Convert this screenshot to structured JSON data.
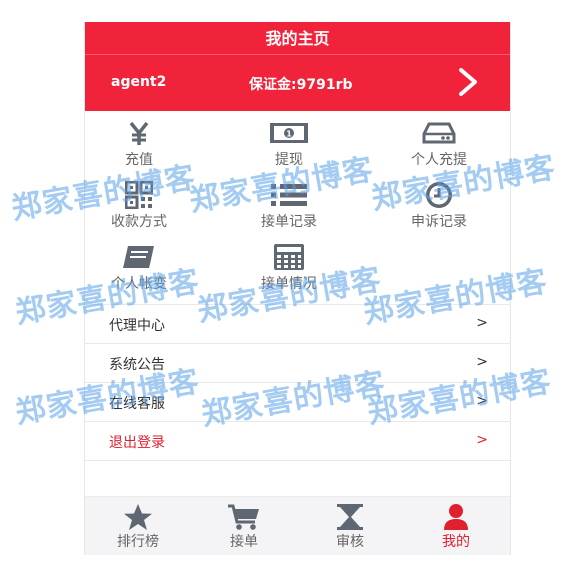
{
  "header": {
    "title": "我的主页"
  },
  "user": {
    "name": "agent2",
    "deposit": "保证金:9791rb"
  },
  "grid": [
    {
      "label": "充值",
      "icon": "yen-icon"
    },
    {
      "label": "提现",
      "icon": "banknote-icon"
    },
    {
      "label": "个人充提",
      "icon": "hard-drive-icon"
    },
    {
      "label": "收款方式",
      "icon": "qrcode-icon"
    },
    {
      "label": "接单记录",
      "icon": "list-icon"
    },
    {
      "label": "申诉记录",
      "icon": "clock-icon"
    },
    {
      "label": "个人帐变",
      "icon": "book-icon"
    },
    {
      "label": "接单情况",
      "icon": "calculator-icon"
    }
  ],
  "menu": [
    {
      "label": "代理中心",
      "chevron": ">"
    },
    {
      "label": "系统公告",
      "chevron": ">"
    },
    {
      "label": "在线客服",
      "chevron": ">"
    },
    {
      "label": "退出登录",
      "chevron": ">"
    }
  ],
  "tabs": [
    {
      "label": "排行榜",
      "icon": "star-icon"
    },
    {
      "label": "接单",
      "icon": "cart-icon"
    },
    {
      "label": "审核",
      "icon": "hourglass-icon"
    },
    {
      "label": "我的",
      "icon": "user-icon"
    }
  ],
  "watermark": {
    "text": "郑家喜的博客"
  },
  "colors": {
    "brand": "#f0233b",
    "icon": "#5f6772",
    "logout": "#e0202f"
  }
}
